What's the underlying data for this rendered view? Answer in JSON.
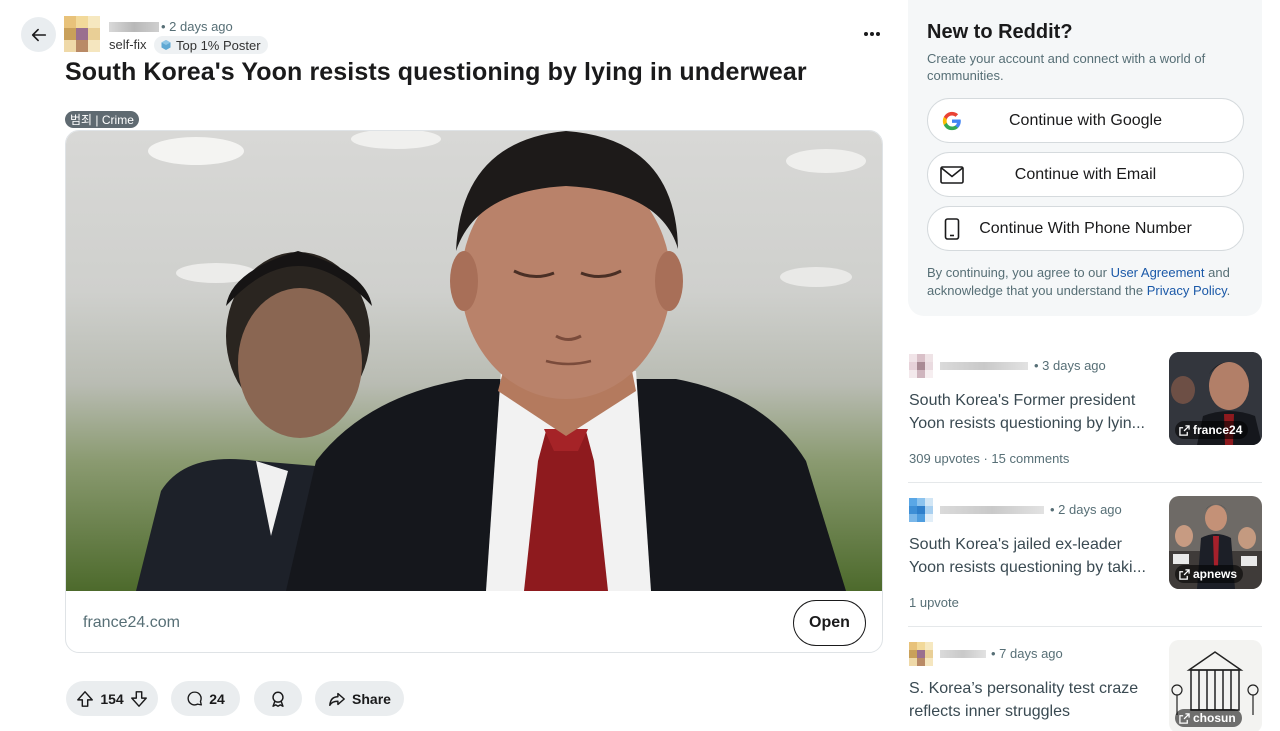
{
  "post": {
    "time": "• 2 days ago",
    "subreddit_flair_user": "self-fix",
    "badge": "Top 1% Poster",
    "title": "South Korea's Yoon resists questioning by lying in underwear",
    "flair": "범죄 | Crime",
    "link_domain": "france24.com",
    "open_label": "Open",
    "upvotes": "154",
    "comments": "24",
    "share_label": "Share"
  },
  "signup": {
    "title": "New to Reddit?",
    "subtitle": "Create your account and connect with a world of communities.",
    "google": "Continue with Google",
    "email": "Continue with Email",
    "phone": "Continue With Phone Number",
    "legal_prefix": "By continuing, you agree to our ",
    "user_agreement": "User Agreement",
    "legal_mid": " and acknowledge that you understand the ",
    "privacy_policy": "Privacy Policy",
    "legal_suffix": "."
  },
  "related": [
    {
      "time": "• 3 days ago",
      "title_line1": "South Korea's Former president",
      "title_line2": "Yoon resists questioning by lyin...",
      "meta": "309 upvotes  ·  15 comments",
      "source": "france24"
    },
    {
      "time": "• 2 days ago",
      "title_line1": "South Korea's jailed ex-leader",
      "title_line2": "Yoon resists questioning by taki...",
      "meta": "1 upvote",
      "source": "apnews"
    },
    {
      "time": "• 7 days ago",
      "title_line1": "S. Korea’s personality test craze",
      "title_line2": "reflects inner struggles",
      "meta": "",
      "source": "chosun"
    }
  ],
  "colors": {
    "link_blue": "#1b59a8",
    "muted_text": "#576f76",
    "pill_bg": "#eaedef"
  }
}
